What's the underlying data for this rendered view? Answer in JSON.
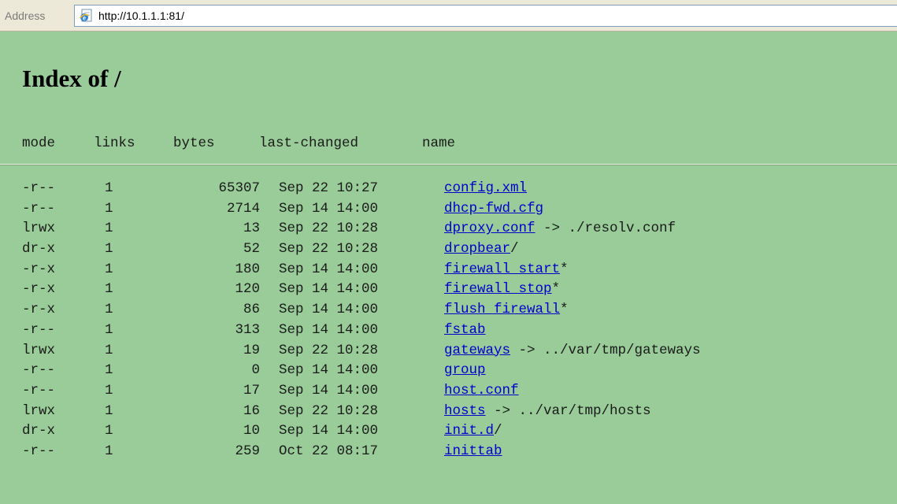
{
  "address_bar": {
    "label": "Address",
    "url": "http://10.1.1.1:81/",
    "icon": "ie-page-icon"
  },
  "page": {
    "title": "Index of /"
  },
  "table": {
    "headers": {
      "mode": "mode",
      "links": "links",
      "bytes": "bytes",
      "last_changed": "last-changed",
      "name": "name"
    },
    "rows": [
      {
        "mode": "-r--",
        "links": "1",
        "bytes": "65307",
        "date": "Sep 22 10:27",
        "name": "config.xml",
        "suffix": ""
      },
      {
        "mode": "-r--",
        "links": "1",
        "bytes": "2714",
        "date": "Sep 14 14:00",
        "name": "dhcp-fwd.cfg",
        "suffix": ""
      },
      {
        "mode": "lrwx",
        "links": "1",
        "bytes": "13",
        "date": "Sep 22 10:28",
        "name": "dproxy.conf",
        "suffix": " -> ./resolv.conf"
      },
      {
        "mode": "dr-x",
        "links": "1",
        "bytes": "52",
        "date": "Sep 22 10:28",
        "name": "dropbear",
        "suffix": "/"
      },
      {
        "mode": "-r-x",
        "links": "1",
        "bytes": "180",
        "date": "Sep 14 14:00",
        "name": "firewall_start",
        "suffix": "*"
      },
      {
        "mode": "-r-x",
        "links": "1",
        "bytes": "120",
        "date": "Sep 14 14:00",
        "name": "firewall_stop",
        "suffix": "*"
      },
      {
        "mode": "-r-x",
        "links": "1",
        "bytes": "86",
        "date": "Sep 14 14:00",
        "name": "flush_firewall",
        "suffix": "*"
      },
      {
        "mode": "-r--",
        "links": "1",
        "bytes": "313",
        "date": "Sep 14 14:00",
        "name": "fstab",
        "suffix": ""
      },
      {
        "mode": "lrwx",
        "links": "1",
        "bytes": "19",
        "date": "Sep 22 10:28",
        "name": "gateways",
        "suffix": " -> ../var/tmp/gateways"
      },
      {
        "mode": "-r--",
        "links": "1",
        "bytes": "0",
        "date": "Sep 14 14:00",
        "name": "group",
        "suffix": ""
      },
      {
        "mode": "-r--",
        "links": "1",
        "bytes": "17",
        "date": "Sep 14 14:00",
        "name": "host.conf",
        "suffix": ""
      },
      {
        "mode": "lrwx",
        "links": "1",
        "bytes": "16",
        "date": "Sep 22 10:28",
        "name": "hosts",
        "suffix": " -> ../var/tmp/hosts"
      },
      {
        "mode": "dr-x",
        "links": "1",
        "bytes": "10",
        "date": "Sep 14 14:00",
        "name": "init.d",
        "suffix": "/"
      },
      {
        "mode": "-r--",
        "links": "1",
        "bytes": "259",
        "date": "Oct 22 08:17",
        "name": "inittab",
        "suffix": ""
      }
    ]
  },
  "colors": {
    "page_background": "#99cc99",
    "link": "#0000cc",
    "text": "#1a1a1a"
  }
}
